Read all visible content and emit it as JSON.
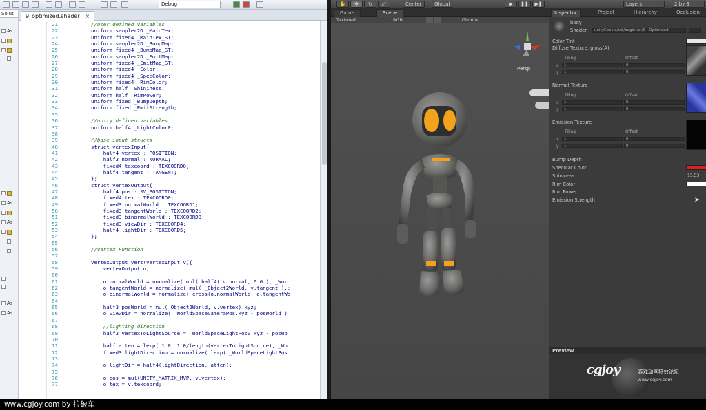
{
  "vs": {
    "file_tab": "9_optimized.shader",
    "close_glyph": "×",
    "debug_config": "Debug",
    "solution_tab": "Solut",
    "tree_labels": [
      "As",
      "As",
      "As",
      "As",
      "As",
      "As"
    ],
    "code": [
      {
        "n": "21",
        "t": "//user defined variables",
        "c": true
      },
      {
        "n": "22",
        "t": "uniform sampler2D _MainTex;"
      },
      {
        "n": "23",
        "t": "uniform fixed4 _MainTex_ST;"
      },
      {
        "n": "24",
        "t": "uniform sampler2D _BumpMap;"
      },
      {
        "n": "25",
        "t": "uniform fixed4 _BumpMap_ST;"
      },
      {
        "n": "26",
        "t": "uniform sampler2D _EmitMap;"
      },
      {
        "n": "27",
        "t": "uniform fixed4 _EmitMap_ST;"
      },
      {
        "n": "28",
        "t": "uniform fixed4 _Color;"
      },
      {
        "n": "29",
        "t": "uniform fixed4 _SpecColor;"
      },
      {
        "n": "30",
        "t": "uniform fixed4 _RimColor;"
      },
      {
        "n": "31",
        "t": "uniform half _Shininess;"
      },
      {
        "n": "32",
        "t": "uniform half _RimPower;"
      },
      {
        "n": "33",
        "t": "uniform fixed _BumpDepth;"
      },
      {
        "n": "34",
        "t": "uniform fixed _EmitStrength;"
      },
      {
        "n": "35",
        "t": ""
      },
      {
        "n": "36",
        "t": "//unity defined variables",
        "c": true
      },
      {
        "n": "37",
        "t": "uniform half4 _LightColor0;"
      },
      {
        "n": "38",
        "t": ""
      },
      {
        "n": "39",
        "t": "//base input structs",
        "c": true
      },
      {
        "n": "40",
        "t": "struct vertexInput{"
      },
      {
        "n": "41",
        "t": "    half4 vertex : POSITION;"
      },
      {
        "n": "42",
        "t": "    half3 normal : NORMAL;"
      },
      {
        "n": "43",
        "t": "    fixed4 texcoord : TEXCOORD0;"
      },
      {
        "n": "44",
        "t": "    half4 tangent : TANGENT;"
      },
      {
        "n": "45",
        "t": "};"
      },
      {
        "n": "46",
        "t": "struct vertexOutput{"
      },
      {
        "n": "47",
        "t": "    half4 pos : SV_POSITION;"
      },
      {
        "n": "48",
        "t": "    fixed4 tex : TEXCOORD0;"
      },
      {
        "n": "49",
        "t": "    fixed3 normalWorld : TEXCOORD1;"
      },
      {
        "n": "50",
        "t": "    fixed3 tangentWorld : TEXCOORD2;"
      },
      {
        "n": "51",
        "t": "    fixed3 binormalWorld : TEXCOORD3;"
      },
      {
        "n": "52",
        "t": "    fixed3 viewDir : TEXCOORD4;"
      },
      {
        "n": "53",
        "t": "    half4 lightDir : TEXCOORD5;"
      },
      {
        "n": "54",
        "t": "};"
      },
      {
        "n": "55",
        "t": ""
      },
      {
        "n": "56",
        "t": "//vertex Function",
        "c": true
      },
      {
        "n": "57",
        "t": ""
      },
      {
        "n": "58",
        "t": "vertexOutput vert(vertexInput v){"
      },
      {
        "n": "59",
        "t": "    vertexOutput o;"
      },
      {
        "n": "60",
        "t": ""
      },
      {
        "n": "61",
        "t": "    o.normalWorld = normalize( mul( half4( v.normal, 0.0 ), _Wor"
      },
      {
        "n": "62",
        "t": "    o.tangentWorld = normalize( mul( _Object2World, v.tangent ).:"
      },
      {
        "n": "63",
        "t": "    o.binormalWorld = normalize( cross(o.normalWorld, o.tangentWo"
      },
      {
        "n": "64",
        "t": ""
      },
      {
        "n": "65",
        "t": "    half3 posWorld = mul(_Object2World, v.vertex).xyz;"
      },
      {
        "n": "66",
        "t": "    o.viewDir = normalize( _WorldSpaceCameraPos.xyz - posWorld )"
      },
      {
        "n": "67",
        "t": ""
      },
      {
        "n": "68",
        "t": "    //lighting direction",
        "c": true
      },
      {
        "n": "69",
        "t": "    half3 vertexToLightSource = _WorldSpaceLightPos0.xyz - posWo"
      },
      {
        "n": "70",
        "t": ""
      },
      {
        "n": "71",
        "t": "    half atten = lerp( 1.0, 1.0/length(vertexToLightSource), _Wo"
      },
      {
        "n": "72",
        "t": "    fixed3 lightDirection = normalize( lerp( _WorldSpaceLightPos"
      },
      {
        "n": "73",
        "t": ""
      },
      {
        "n": "74",
        "t": "    o.lightDir = half4(lightDirection, atten);"
      },
      {
        "n": "75",
        "t": ""
      },
      {
        "n": "76",
        "t": "    o.pos = mul(UNITY_MATRIX_MVP, v.vertex);"
      },
      {
        "n": "77",
        "t": "    o.tex = v.texcoord;"
      }
    ]
  },
  "unity": {
    "toolbar": {
      "pivot_center": "Center",
      "pivot_global": "Global",
      "layers": "Layers",
      "layout": "2 by 3"
    },
    "scene_tabs": {
      "game": "Game",
      "scene": "Scene"
    },
    "scene_bar": {
      "shading": "Textured",
      "render_mode": "RGB",
      "gizmos": "Gizmos"
    },
    "persp": "Persp",
    "inspector": {
      "tabs": [
        "Inspector",
        "Project",
        "Hierarchy",
        "Occlusion"
      ],
      "object_name": "body",
      "shader_label": "Shader",
      "shader_value": "unityCookie/tut/beginner/9 - Optimized",
      "props": {
        "color_tint": "Color Tint",
        "diffuse": "Diffuse Texture, gloss(A)",
        "normal": "Normal Texture",
        "emission": "Emission Texture",
        "bump_depth": "Bump Depth",
        "specular": "Specular Color",
        "shininess": "Shininess",
        "shininess_value": "15.53",
        "rim_color": "Rim Color",
        "rim_power": "Rim Power",
        "emission_strength": "Emission Strength"
      },
      "tiling": "Tiling",
      "offset": "Offset",
      "x": "x",
      "y": "y",
      "one": "1",
      "zero": "0",
      "preview": "Preview"
    },
    "colors": {
      "specular": "#e02020",
      "rim": "#ffffff",
      "robot_glow": "#f2a21b"
    }
  },
  "watermark": {
    "logo": "cgjoy",
    "cn": "游戏动画特效论坛",
    "url": "www.cgjoy.com"
  },
  "footer": {
    "text": "www.cgjoy.com by 拉破车"
  }
}
